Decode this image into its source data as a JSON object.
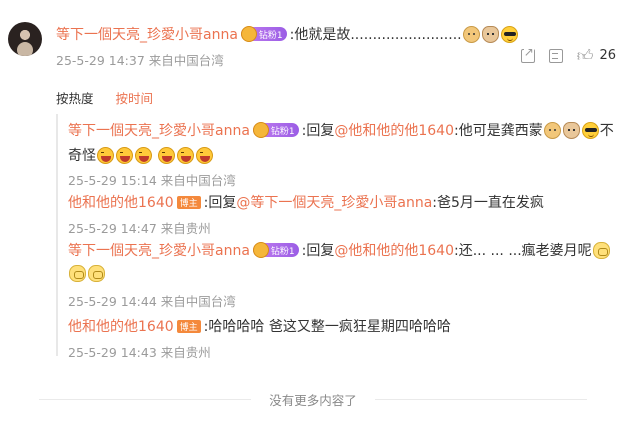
{
  "comment": {
    "username": "等下一個天亮_珍愛小哥anna",
    "badge": "钻粉1",
    "text": ":他就是故.........................",
    "emojis": [
      "doge-emoji",
      "cat-emoji",
      "cool-emoji"
    ],
    "meta": "25-5-29 14:37 来自中国台湾",
    "like_count": "26"
  },
  "sort": {
    "hot": "按热度",
    "time": "按时间"
  },
  "replies": [
    {
      "username": "等下一個天亮_珍愛小哥anna",
      "badge": "钻粉1",
      "prefix": ":回复",
      "mention": "@他和他的他1640",
      "text": ":他可是龚西蒙",
      "text2": "不",
      "text3": "奇怪",
      "meta": "25-5-29 15:14 来自中国台湾"
    },
    {
      "username": "他和他的他1640",
      "badge": "博主",
      "prefix": ":回复",
      "mention": "@等下一個天亮_珍愛小哥anna",
      "text": ":爸5月一直在发疯",
      "meta": "25-5-29 14:47 来自贵州"
    },
    {
      "username": "等下一個天亮_珍愛小哥anna",
      "badge": "钻粉1",
      "prefix": ":回复",
      "mention": "@他和他的他1640",
      "text": ":还... ... ...瘋老婆月呢",
      "meta": "25-5-29 14:44 来自中国台湾"
    },
    {
      "username": "他和他的他1640",
      "badge": "博主",
      "text": ":哈哈哈哈 爸这又整一疯狂星期四哈哈哈",
      "meta": "25-5-29 14:43 来自贵州"
    }
  ],
  "footer": {
    "text": "没有更多内容了"
  },
  "colors": {
    "accent": "#eb7350",
    "meta": "#9b9b9b",
    "diamond_badge": "#9b5de5",
    "host_badge": "#f4893c"
  }
}
